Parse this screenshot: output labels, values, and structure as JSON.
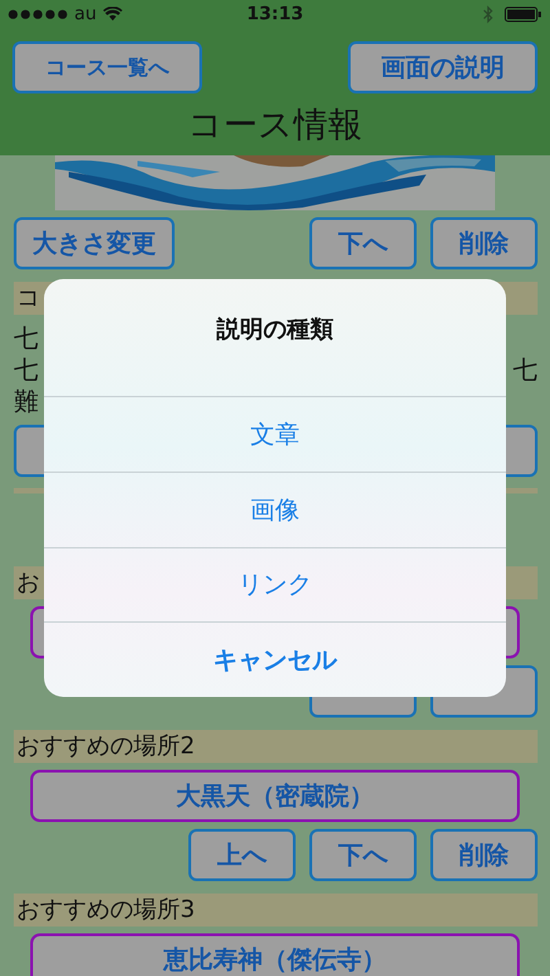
{
  "status_bar": {
    "carrier": "au",
    "time": "13:13"
  },
  "nav": {
    "left_button": "コース一覧へ",
    "right_button": "画面の説明",
    "title": "コース情報"
  },
  "content": [
    {
      "kind": "picture"
    },
    {
      "kind": "buttons",
      "left": [
        {
          "label": "大きさ変更"
        }
      ],
      "right": [
        {
          "label": "下へ"
        },
        {
          "label": "削除"
        }
      ]
    },
    {
      "kind": "header",
      "text": "コ"
    },
    {
      "kind": "text",
      "lines": [
        {
          "left": "七"
        },
        {
          "left": "七",
          "right": "七"
        },
        {
          "left": "難"
        }
      ]
    },
    {
      "kind": "buttons",
      "left": [
        {
          "covered": true
        }
      ],
      "right": [
        {
          "covered": true
        }
      ]
    },
    {
      "kind": "separator"
    },
    {
      "kind": "header",
      "text": "お"
    },
    {
      "kind": "place",
      "covered": true
    },
    {
      "kind": "buttons",
      "right": [
        {
          "covered": true
        },
        {
          "covered": true
        }
      ]
    },
    {
      "kind": "header",
      "text": "おすすめの場所2"
    },
    {
      "kind": "place",
      "label": "大黒天（密蔵院）"
    },
    {
      "kind": "buttons",
      "right": [
        {
          "label": "上へ"
        },
        {
          "label": "下へ"
        },
        {
          "label": "削除"
        }
      ]
    },
    {
      "kind": "header",
      "text": "おすすめの場所3"
    },
    {
      "kind": "place",
      "label": "恵比寿神（傑伝寺）"
    }
  ],
  "dialog": {
    "title": "説明の種類",
    "actions": [
      {
        "label": "文章",
        "kind": "default"
      },
      {
        "label": "画像",
        "kind": "default"
      },
      {
        "label": "リンク",
        "kind": "default"
      },
      {
        "label": "キャンセル",
        "kind": "cancel"
      }
    ]
  }
}
